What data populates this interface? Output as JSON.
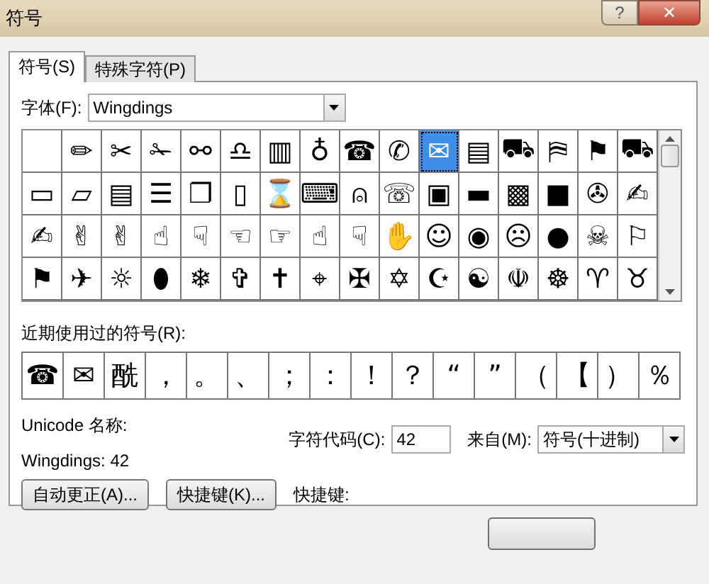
{
  "window": {
    "title": "符号",
    "help": "?",
    "close": "✕"
  },
  "tabs": [
    {
      "label": "符号(S)",
      "selected": true
    },
    {
      "label": "特殊字符(P)",
      "selected": false
    }
  ],
  "font": {
    "label": "字体(F):",
    "value": "Wingdings"
  },
  "symbols": [
    [
      {
        "selected": false
      },
      {
        "glyph": "✏",
        "selected": false
      },
      {
        "glyph": "✂",
        "selected": false
      },
      {
        "glyph": "✁",
        "selected": false
      },
      {
        "glyph": "⚯",
        "selected": false
      },
      {
        "glyph": "♎",
        "selected": false
      },
      {
        "glyph": "▥",
        "selected": false
      },
      {
        "glyph": "♁",
        "selected": false
      },
      {
        "glyph": "☎",
        "selected": false
      },
      {
        "glyph": "✆",
        "selected": false
      },
      {
        "glyph": "✉",
        "selected": true
      },
      {
        "glyph": "▤",
        "selected": false
      },
      {
        "glyph": "⛟",
        "selected": false
      },
      {
        "glyph": "⛿",
        "selected": false
      },
      {
        "glyph": "⚑",
        "selected": false
      },
      {
        "glyph": "⛟",
        "selected": false
      }
    ],
    [
      {
        "glyph": "▭",
        "selected": false
      },
      {
        "glyph": "▱",
        "selected": false
      },
      {
        "glyph": "▤",
        "selected": false
      },
      {
        "glyph": "☰",
        "selected": false
      },
      {
        "glyph": "❐",
        "selected": false
      },
      {
        "glyph": "▯",
        "selected": false
      },
      {
        "glyph": "⌛",
        "selected": false
      },
      {
        "glyph": "⌨",
        "selected": false
      },
      {
        "glyph": "⍝",
        "selected": false
      },
      {
        "glyph": "☏",
        "selected": false
      },
      {
        "glyph": "▣",
        "selected": false
      },
      {
        "glyph": "▬",
        "selected": false
      },
      {
        "glyph": "▩",
        "selected": false
      },
      {
        "glyph": "■",
        "selected": false
      },
      {
        "glyph": "✇",
        "selected": false
      },
      {
        "glyph": "✍",
        "selected": false
      }
    ],
    [
      {
        "glyph": "✍",
        "selected": false
      },
      {
        "glyph": "✌",
        "selected": false
      },
      {
        "glyph": "✌",
        "selected": false
      },
      {
        "glyph": "☝",
        "selected": false
      },
      {
        "glyph": "☟",
        "selected": false
      },
      {
        "glyph": "☜",
        "selected": false
      },
      {
        "glyph": "☞",
        "selected": false
      },
      {
        "glyph": "☝",
        "selected": false
      },
      {
        "glyph": "☟",
        "selected": false
      },
      {
        "glyph": "✋",
        "selected": false
      },
      {
        "glyph": "☺",
        "selected": false
      },
      {
        "glyph": "◉",
        "selected": false
      },
      {
        "glyph": "☹",
        "selected": false
      },
      {
        "glyph": "●",
        "selected": false
      },
      {
        "glyph": "☠",
        "selected": false
      },
      {
        "glyph": "⚐",
        "selected": false
      }
    ],
    [
      {
        "glyph": "⚑",
        "selected": false
      },
      {
        "glyph": "✈",
        "selected": false
      },
      {
        "glyph": "☼",
        "selected": false
      },
      {
        "glyph": "⬮",
        "selected": false
      },
      {
        "glyph": "❄",
        "selected": false
      },
      {
        "glyph": "✞",
        "selected": false
      },
      {
        "glyph": "✝",
        "selected": false
      },
      {
        "glyph": "⌖",
        "selected": false
      },
      {
        "glyph": "✠",
        "selected": false
      },
      {
        "glyph": "✡",
        "selected": false
      },
      {
        "glyph": "☪",
        "selected": false
      },
      {
        "glyph": "☯",
        "selected": false
      },
      {
        "glyph": "☫",
        "selected": false
      },
      {
        "glyph": "☸",
        "selected": false
      },
      {
        "glyph": "♈",
        "selected": false
      },
      {
        "glyph": "♉",
        "selected": false
      }
    ]
  ],
  "recent": {
    "label": "近期使用过的符号(R):",
    "items": [
      "☎",
      "✉",
      "酰",
      "，",
      "。",
      "、",
      "；",
      "：",
      "！",
      "？",
      "“",
      "”",
      "（",
      "【",
      "）",
      "％"
    ]
  },
  "unicode_name": {
    "label": "Unicode 名称:",
    "value": "Wingdings: 42"
  },
  "char_code": {
    "label": "字符代码(C):",
    "value": "42"
  },
  "from": {
    "label": "来自(M):",
    "value": "符号(十进制)"
  },
  "buttons": [
    "自动更正(A)...",
    "快捷键(K)..."
  ],
  "shortcut": {
    "label": "快捷键:"
  }
}
